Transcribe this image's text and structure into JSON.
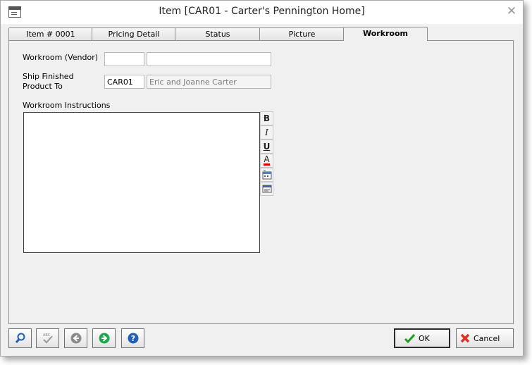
{
  "window": {
    "title": "Item [CAR01 - Carter's Pennington Home]"
  },
  "tabs": [
    {
      "label": "Item # 0001"
    },
    {
      "label": "Pricing Detail"
    },
    {
      "label": "Status"
    },
    {
      "label": "Picture"
    },
    {
      "label": "Workroom"
    }
  ],
  "active_tab": "Workroom",
  "form": {
    "vendor_label": "Workroom (Vendor)",
    "vendor_code": "",
    "vendor_name": "",
    "ship_label_line1": "Ship Finished",
    "ship_label_line2": "Product To",
    "ship_code": "CAR01",
    "ship_name": "Eric and Joanne Carter",
    "instructions_label": "Workroom Instructions",
    "instructions_text": ""
  },
  "format_toolbar": {
    "bold": "B",
    "italic": "I",
    "underline": "U",
    "font_color": "A"
  },
  "buttons": {
    "ok_label": "OK",
    "cancel_label": "Cancel"
  },
  "colors": {
    "ok_check": "#1a9e1a",
    "cancel_x": "#e03020",
    "nav_green": "#1aa84a",
    "help_blue": "#1f5fb5",
    "font_color_bar": "#e00000"
  }
}
